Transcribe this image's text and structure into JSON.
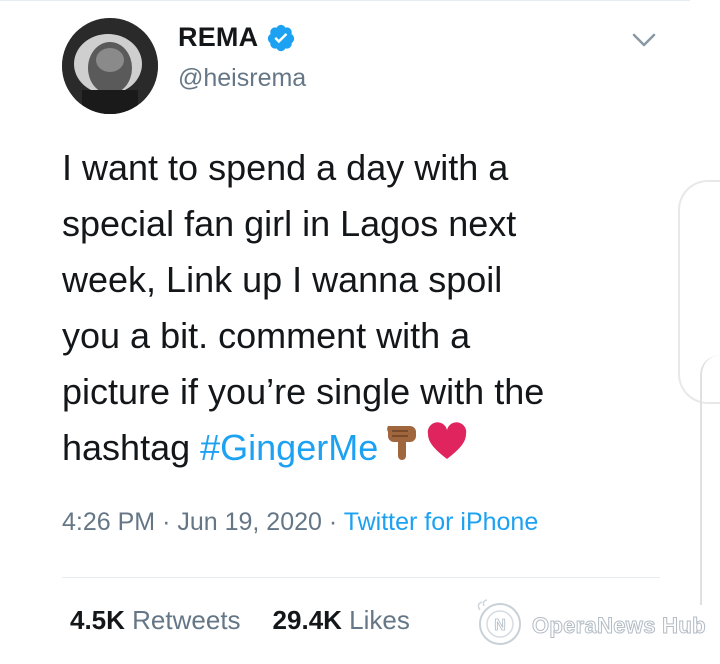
{
  "tweet": {
    "display_name": "REMA",
    "handle": "@heisrema",
    "text_lines": [
      "I want to spend a day with a",
      "special fan girl in Lagos next",
      "week, Link up I wanna spoil",
      "you a bit. comment with a",
      "picture if you’re single with the"
    ],
    "last_line_prefix": "hashtag ",
    "hashtag": "#GingerMe",
    "emojis": [
      "backhand-index-pointing-down",
      "red-heart"
    ],
    "time": "4:26 PM",
    "separator": "·",
    "date": "Jun 19, 2020",
    "source": "Twitter for iPhone",
    "retweets_count": "4.5K",
    "retweets_label": "Retweets",
    "likes_count": "29.4K",
    "likes_label": "Likes"
  },
  "icons": {
    "verified": "verified-badge-icon",
    "menu": "chevron-down-icon"
  },
  "watermark": {
    "text": "OperaNews Hub"
  },
  "colors": {
    "link": "#1da1f2",
    "muted": "#657786",
    "text": "#14171a",
    "heart": "#e0245e",
    "hand": "#a0673f"
  }
}
